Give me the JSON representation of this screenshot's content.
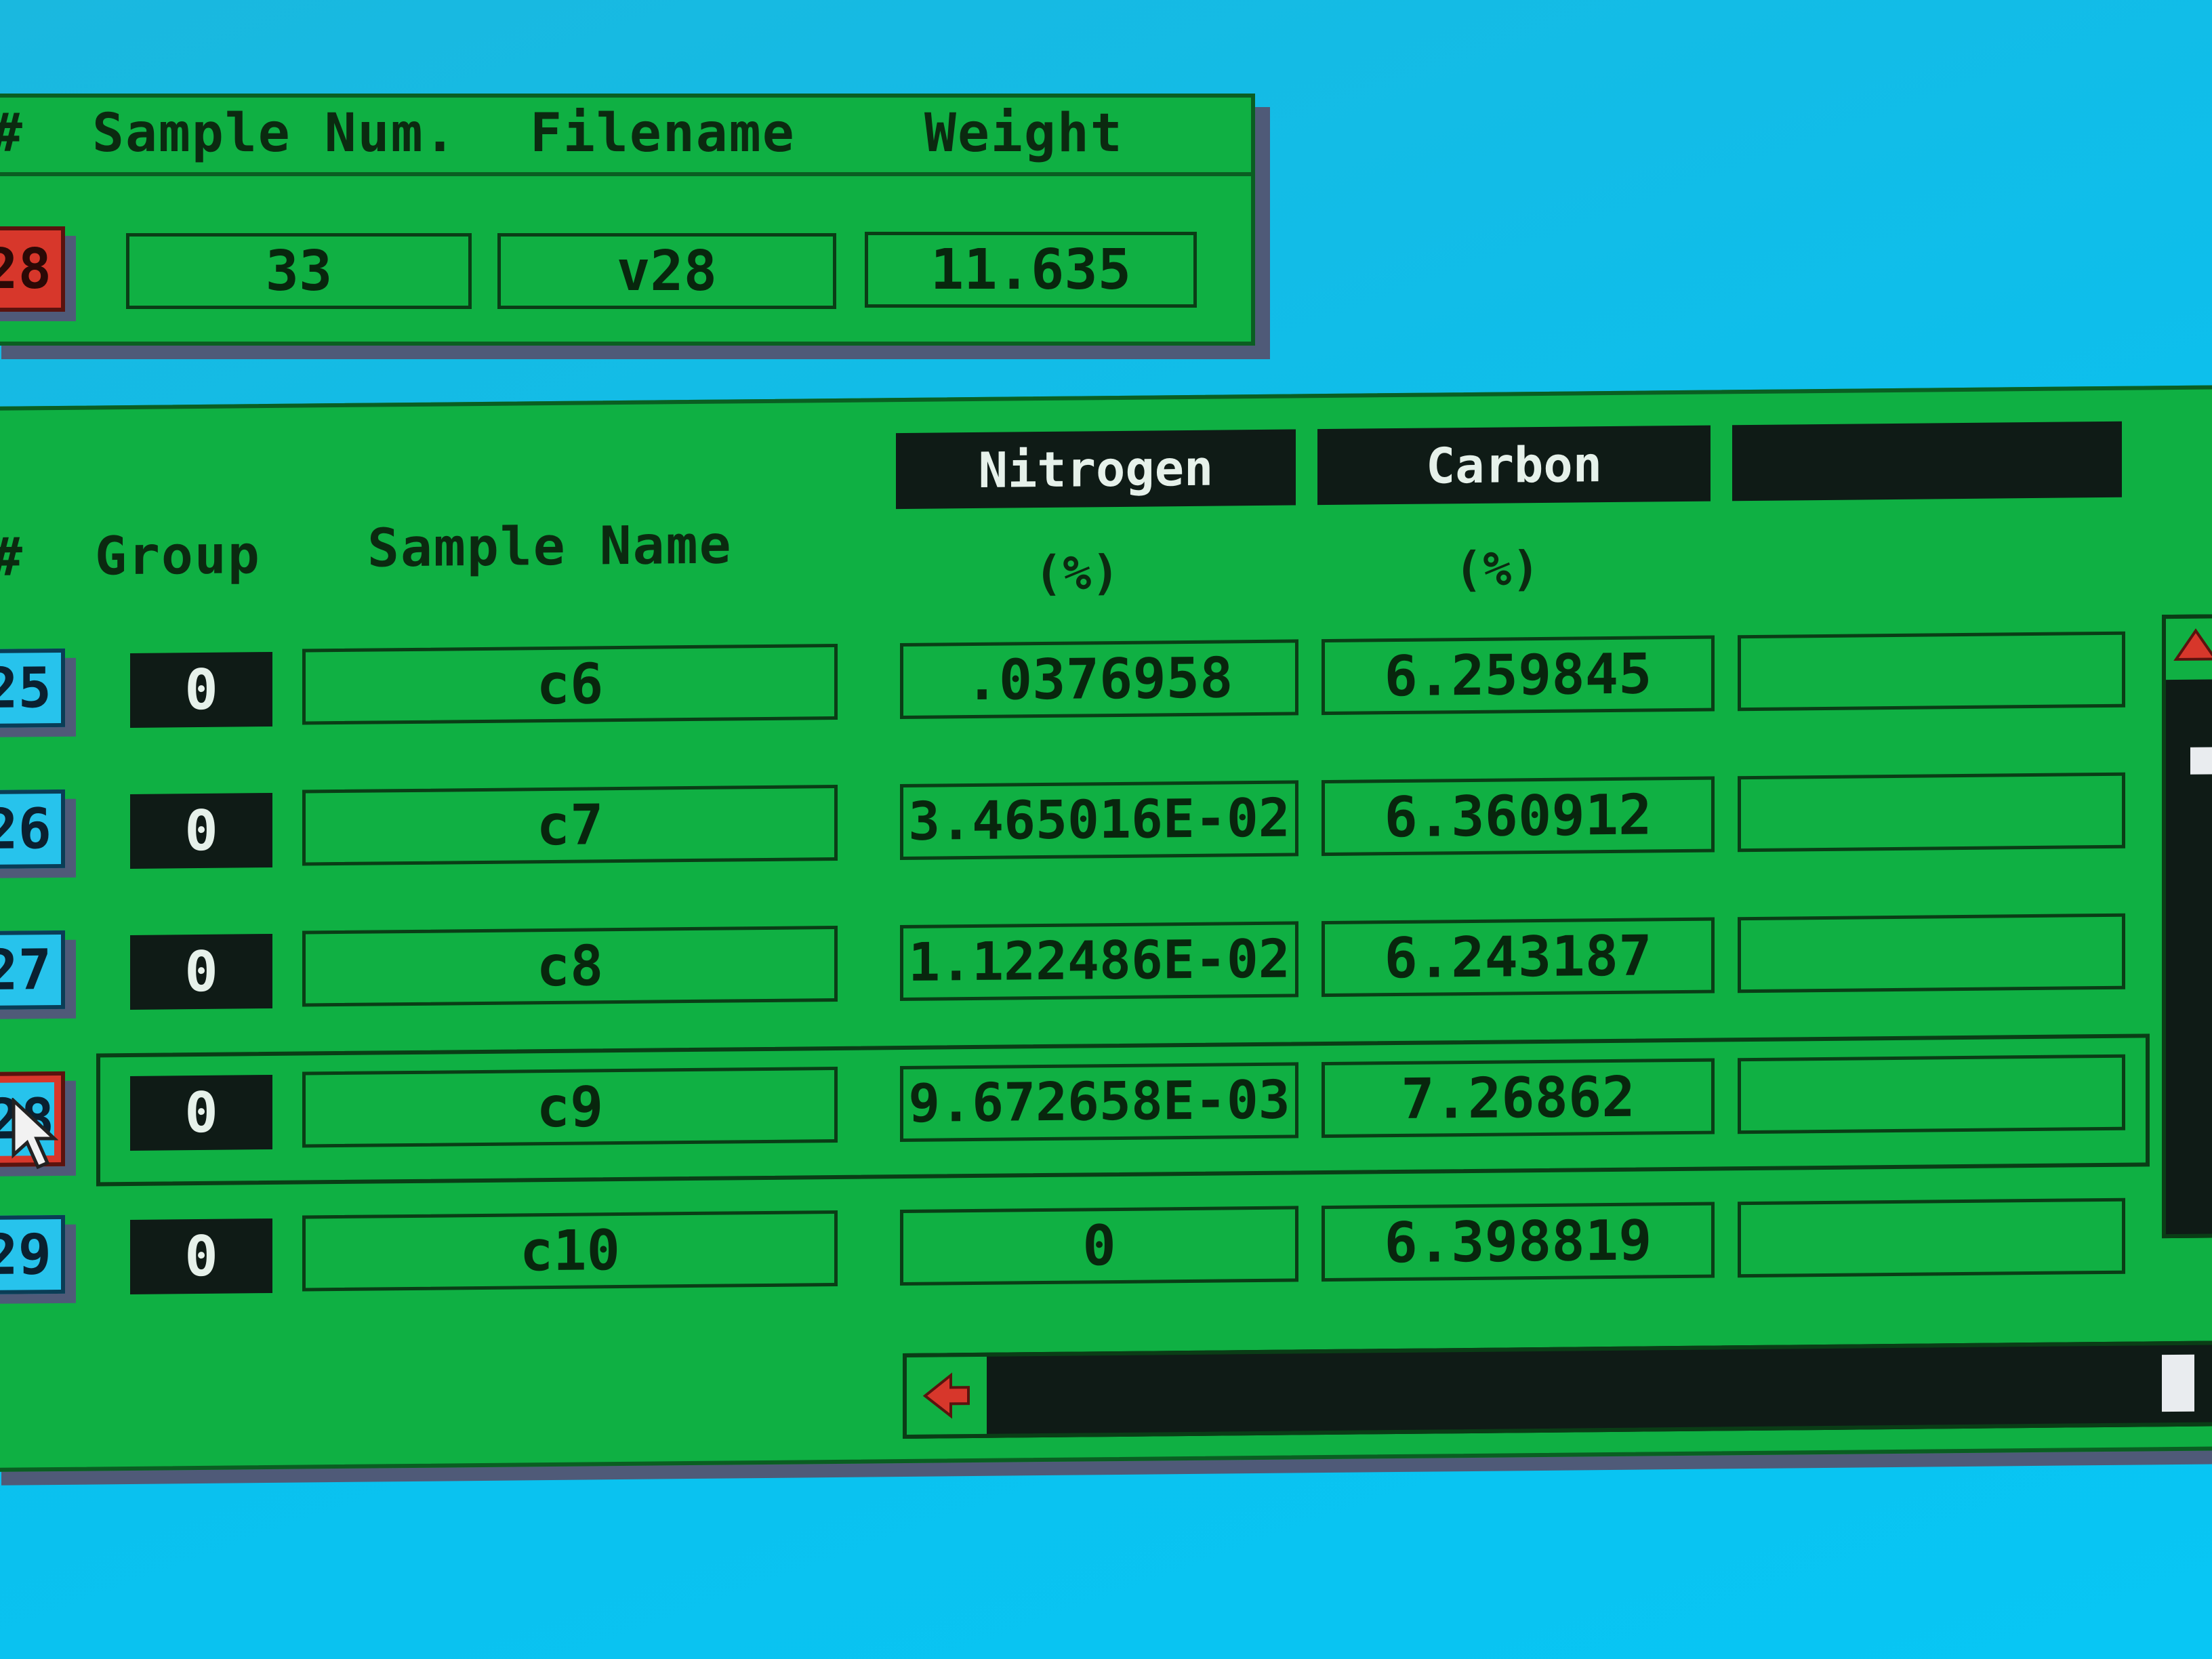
{
  "top_panel": {
    "headers": {
      "num": "#",
      "sample_num": "Sample Num.",
      "filename": "Filename",
      "weight": "Weight"
    },
    "row": {
      "num": "28",
      "sample_num": "33",
      "filename": "v28",
      "weight": "11.635"
    }
  },
  "table_panel": {
    "headers": {
      "num": "#",
      "group": "Group",
      "sample_name": "Sample Name",
      "col1": "Nitrogen",
      "col2": "Carbon",
      "col3": ""
    },
    "units": {
      "col1": "(%)",
      "col2": "(%)"
    },
    "rows": [
      {
        "num": "25",
        "group": "0",
        "sample_name": "c6",
        "nitrogen": ".0376958",
        "carbon": "6.259845",
        "extra": ""
      },
      {
        "num": "26",
        "group": "0",
        "sample_name": "c7",
        "nitrogen": "3.465016E-02",
        "carbon": "6.360912",
        "extra": ""
      },
      {
        "num": "27",
        "group": "0",
        "sample_name": "c8",
        "nitrogen": "1.122486E-02",
        "carbon": "6.243187",
        "extra": ""
      },
      {
        "num": "28",
        "group": "0",
        "sample_name": "c9",
        "nitrogen": "9.672658E-03",
        "carbon": "7.26862",
        "extra": ""
      },
      {
        "num": "29",
        "group": "0",
        "sample_name": "c10",
        "nitrogen": "0",
        "carbon": "6.398819",
        "extra": ""
      }
    ]
  },
  "icons": {
    "scroll_left": "arrow-left-icon",
    "scroll_up": "arrow-up-icon",
    "pointer": "mouse-pointer-icon"
  },
  "colors": {
    "panel_green": "#0fb043",
    "row_num_cyan": "#27c3ec",
    "selected_red": "#d7372b",
    "header_black": "#0f1b16",
    "background_cyan": "#0bc0ee"
  }
}
